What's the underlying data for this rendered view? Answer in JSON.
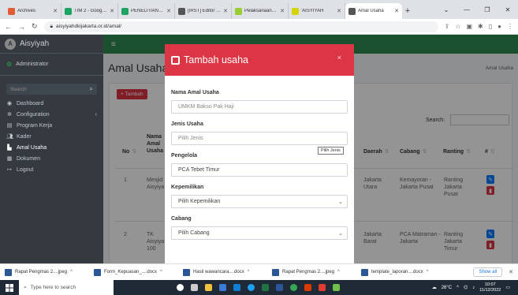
{
  "browser": {
    "tabs": [
      {
        "label": "Archives",
        "favicon_color": "#e25d33"
      },
      {
        "label": "TIM 2 - Google D",
        "favicon_color": "#1fa463"
      },
      {
        "label": "PENELITIAN LPPM",
        "favicon_color": "#1fa463"
      },
      {
        "label": "[IRST] Editor Dec",
        "favicon_color": "#555555"
      },
      {
        "label": "Pelaksanaan Keg",
        "favicon_color": "#9acd32"
      },
      {
        "label": "'AISYIYAH",
        "favicon_color": "#d4d400"
      },
      {
        "label": "Amal Usaha",
        "favicon_color": "#555555",
        "active": true
      }
    ],
    "new_tab": "+",
    "url": "aisyiyahdkijakarta.or.id/amal/"
  },
  "sidebar": {
    "brand": "Aisyiyah",
    "user": "Administrator",
    "search_placeholder": "Search",
    "items": [
      {
        "label": "Dashboard",
        "icon": "dashboard-icon"
      },
      {
        "label": "Configuration",
        "icon": "gear-icon",
        "has_chevron": true
      },
      {
        "label": "Program Kerja",
        "icon": "briefcase-icon"
      },
      {
        "label": "Kader",
        "icon": "users-icon"
      },
      {
        "label": "Amal Usaha",
        "icon": "building-icon",
        "active": true
      },
      {
        "label": "Dokumen",
        "icon": "document-icon"
      },
      {
        "label": "Logout",
        "icon": "logout-icon"
      }
    ]
  },
  "page": {
    "title": "Amal Usaha",
    "breadcrumb": "Amal Usaha",
    "add_button": "+ Tambah",
    "search_label": "Search:"
  },
  "table": {
    "headers": {
      "no": "No",
      "nama": "Nama Amal Usaha",
      "daerah": "Daerah",
      "cabang": "Cabang",
      "ranting": "Ranting",
      "aksi": "#"
    },
    "rows": [
      {
        "no": "1",
        "nama": "Mesjid Aisyiya",
        "daerah": "Jakarta Utara",
        "cabang": "Kemayoran - Jakarta Pusat",
        "ranting": "Ranting Jakarta Pusat"
      },
      {
        "no": "2",
        "nama": "TK Aisyiya 100",
        "daerah": "Jakarta Barat",
        "cabang": "PCA Matraman - Jakarta",
        "ranting": "Ranting Jakarta Timur"
      }
    ]
  },
  "modal": {
    "title": "Tambah usaha",
    "close": "×",
    "fields": [
      {
        "label": "Nama Amal Usaha",
        "value": "UMKM Bakso Pak Haji",
        "type": "input"
      },
      {
        "label": "Jenis Usaha",
        "value": "Pilih Jenis",
        "type": "input"
      },
      {
        "label": "Pengelola",
        "value": "PCA Tebet Timur",
        "type": "input"
      },
      {
        "label": "Kepemilikan",
        "value": "Pilih Kepemilikan",
        "type": "select"
      },
      {
        "label": "Cabang",
        "value": "Pilih Cabang",
        "type": "select"
      }
    ],
    "tooltip": "Pilih Jenis"
  },
  "downloads": {
    "items": [
      "Rapat Pengmas 2....jpeg",
      "Form_Kepuasan_....docx",
      "Hasil wawancara....docx",
      "Rapat Pengmas 2....jpeg",
      "template_laporan....docx"
    ],
    "show_all": "Show all"
  },
  "taskbar": {
    "search_placeholder": "Type here to search",
    "temperature": "26°C",
    "time": "10:07",
    "date": "11/12/2022"
  }
}
